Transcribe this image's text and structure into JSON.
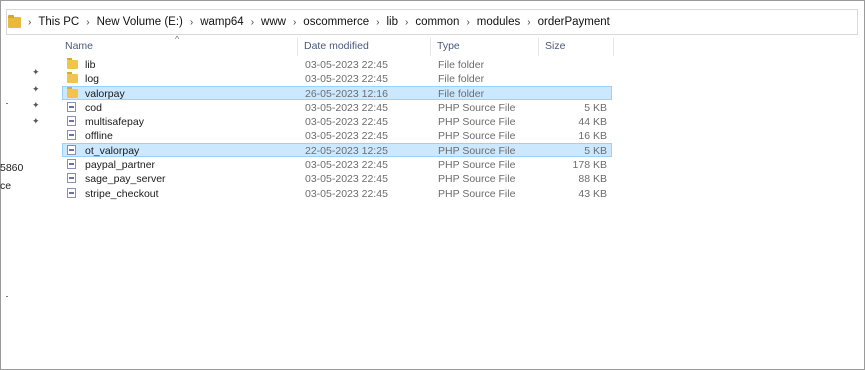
{
  "breadcrumb": [
    "This PC",
    "New Volume (E:)",
    "wamp64",
    "www",
    "oscommerce",
    "lib",
    "common",
    "modules",
    "orderPayment"
  ],
  "nav_pane": {
    "text_lines": [
      "5860",
      "ce"
    ],
    "pin_icon_count": 4
  },
  "columns": {
    "name": "Name",
    "date": "Date modified",
    "type": "Type",
    "size": "Size"
  },
  "files": [
    {
      "name": "lib",
      "date": "03-05-2023 22:45",
      "type": "File folder",
      "size": "",
      "icon": "folder-icon",
      "selected": false
    },
    {
      "name": "log",
      "date": "03-05-2023 22:45",
      "type": "File folder",
      "size": "",
      "icon": "folder-icon",
      "selected": false
    },
    {
      "name": "valorpay",
      "date": "26-05-2023 12:16",
      "type": "File folder",
      "size": "",
      "icon": "folder-icon",
      "selected": true
    },
    {
      "name": "cod",
      "date": "03-05-2023 22:45",
      "type": "PHP Source File",
      "size": "5 KB",
      "icon": "php-file-icon",
      "selected": false
    },
    {
      "name": "multisafepay",
      "date": "03-05-2023 22:45",
      "type": "PHP Source File",
      "size": "44 KB",
      "icon": "php-file-icon",
      "selected": false
    },
    {
      "name": "offline",
      "date": "03-05-2023 22:45",
      "type": "PHP Source File",
      "size": "16 KB",
      "icon": "php-file-icon",
      "selected": false
    },
    {
      "name": "ot_valorpay",
      "date": "22-05-2023 12:25",
      "type": "PHP Source File",
      "size": "5 KB",
      "icon": "php-file-icon",
      "selected": true
    },
    {
      "name": "paypal_partner",
      "date": "03-05-2023 22:45",
      "type": "PHP Source File",
      "size": "178 KB",
      "icon": "php-file-icon",
      "selected": false
    },
    {
      "name": "sage_pay_server",
      "date": "03-05-2023 22:45",
      "type": "PHP Source File",
      "size": "88 KB",
      "icon": "php-file-icon",
      "selected": false
    },
    {
      "name": "stripe_checkout",
      "date": "03-05-2023 22:45",
      "type": "PHP Source File",
      "size": "43 KB",
      "icon": "php-file-icon",
      "selected": false
    }
  ],
  "colors": {
    "selection_bg": "#cce8ff",
    "selection_border": "#99d1ff",
    "header_text": "#4a5a7a",
    "folder": "#f2c44e"
  }
}
